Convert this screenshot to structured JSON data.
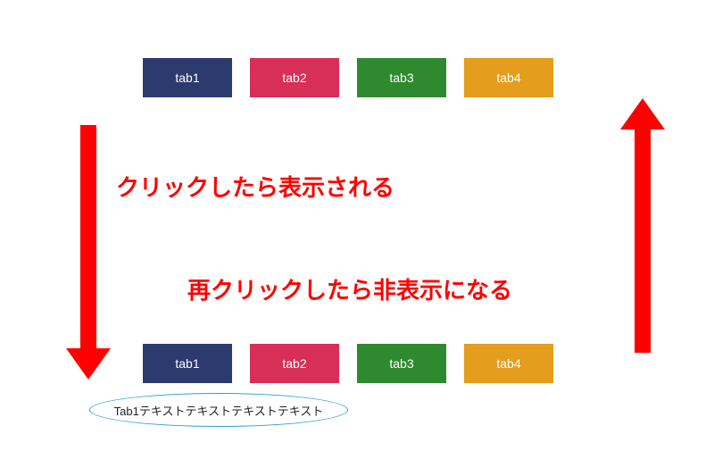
{
  "tabs_top": [
    {
      "label": "tab1",
      "color_class": "tab-1"
    },
    {
      "label": "tab2",
      "color_class": "tab-2"
    },
    {
      "label": "tab3",
      "color_class": "tab-3"
    },
    {
      "label": "tab4",
      "color_class": "tab-4"
    }
  ],
  "tabs_bottom": [
    {
      "label": "tab1",
      "color_class": "tab-1"
    },
    {
      "label": "tab2",
      "color_class": "tab-2"
    },
    {
      "label": "tab3",
      "color_class": "tab-3"
    },
    {
      "label": "tab4",
      "color_class": "tab-4"
    }
  ],
  "annotations": {
    "show_on_click": "クリックしたら表示される",
    "hide_on_reclick": "再クリックしたら非表示になる"
  },
  "bubble_text": "Tab1テキストテキストテキストテキスト",
  "colors": {
    "tab1": "#2d3a6e",
    "tab2": "#d72f57",
    "tab3": "#2f8a2f",
    "tab4": "#e59d1d",
    "annotation": "#ff0000",
    "bubble_border": "#2e9fd6"
  }
}
